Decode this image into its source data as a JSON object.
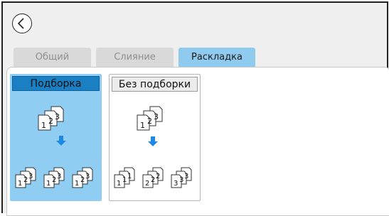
{
  "toolbar": {
    "back_icon": "back-arrow-icon"
  },
  "tabs": [
    {
      "label": "Общий",
      "active": false
    },
    {
      "label": "Слияние",
      "active": false
    },
    {
      "label": "Раскладка",
      "active": true
    }
  ],
  "options": [
    {
      "label": "Подборка",
      "selected": true
    },
    {
      "label": "Без подборки",
      "selected": false
    }
  ],
  "colors": {
    "accent": "#8fcbee",
    "selected_card": "#8fcdf3",
    "selected_label": "#1b7fc4",
    "arrow": "#1e88e5"
  }
}
